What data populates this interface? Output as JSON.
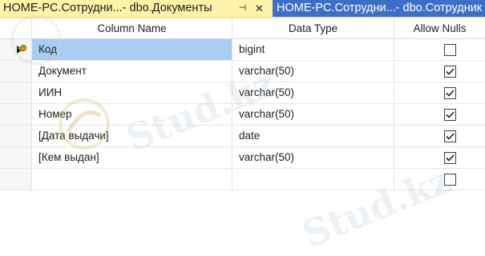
{
  "tabs": [
    {
      "label": "HOME-PC.Сотрудни...- dbo.Документы",
      "active": true
    },
    {
      "label": "HOME-PC.Сотрудни...- dbo.Сотрудник",
      "active": false
    }
  ],
  "tab_icons": {
    "pin": "pin-icon",
    "close": "close-icon"
  },
  "columns": {
    "name": "Column Name",
    "type": "Data Type",
    "nulls": "Allow Nulls"
  },
  "rows": [
    {
      "name": "Код",
      "type": "bigint",
      "allow_nulls": false,
      "primary_key": true,
      "selected": true
    },
    {
      "name": "Документ",
      "type": "varchar(50)",
      "allow_nulls": true
    },
    {
      "name": "ИИН",
      "type": "varchar(50)",
      "allow_nulls": true
    },
    {
      "name": "Номер",
      "type": "varchar(50)",
      "allow_nulls": true
    },
    {
      "name": "[Дата выдачи]",
      "type": "date",
      "allow_nulls": true
    },
    {
      "name": "[Кем выдан]",
      "type": "varchar(50)",
      "allow_nulls": true
    },
    {
      "name": "",
      "type": "",
      "allow_nulls": false
    }
  ],
  "watermark": {
    "text": "Stud.kz"
  },
  "colors": {
    "active_tab": "#fff3a8",
    "inactive_tab": "#3e6fc8",
    "selection": "#a9ccf2"
  }
}
